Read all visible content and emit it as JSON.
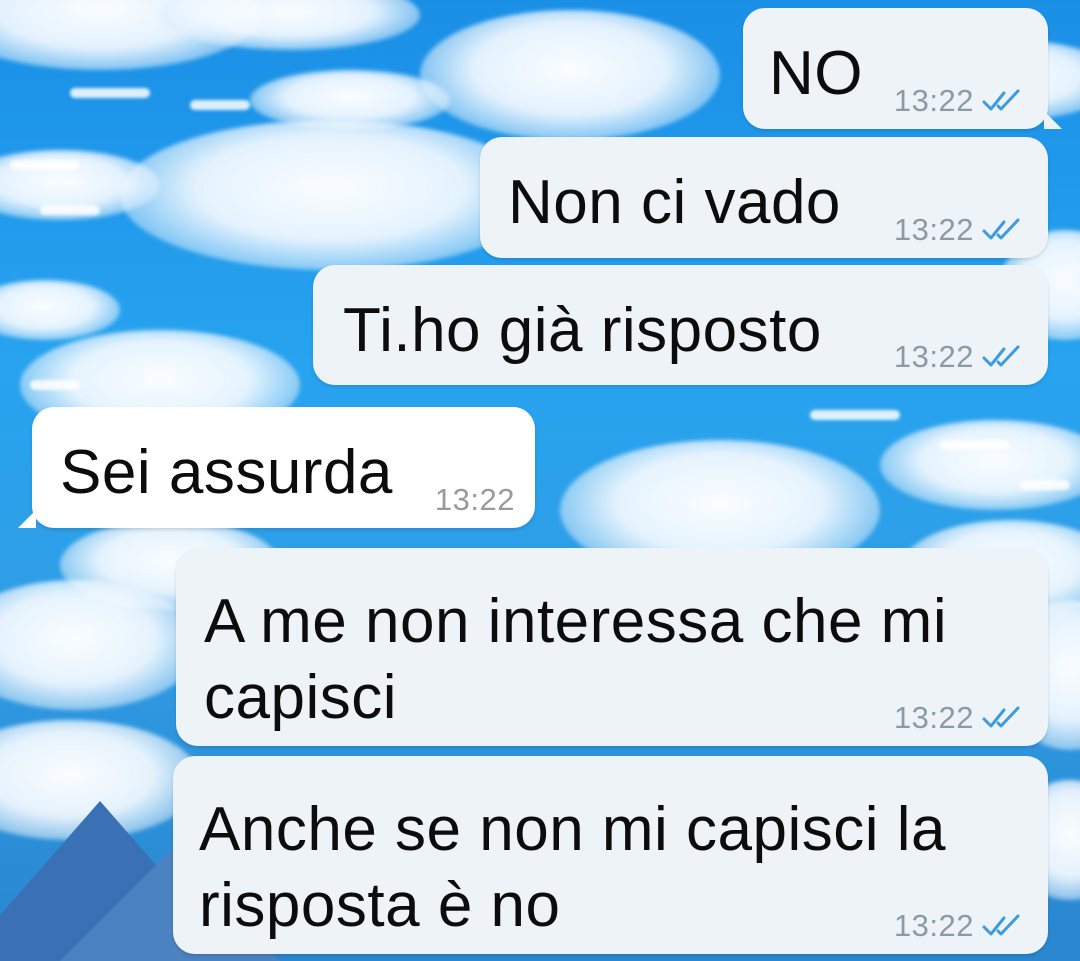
{
  "messages": [
    {
      "text": "NO",
      "time": "13:22",
      "direction": "outgoing",
      "status": "read"
    },
    {
      "text": "Non ci vado",
      "time": "13:22",
      "direction": "outgoing",
      "status": "read"
    },
    {
      "text": "Ti.ho già risposto",
      "time": "13:22",
      "direction": "outgoing",
      "status": "read"
    },
    {
      "text": "Sei assurda",
      "time": "13:22",
      "direction": "incoming"
    },
    {
      "text": "A me non interessa che mi\ncapisci",
      "time": "13:22",
      "direction": "outgoing",
      "status": "read"
    },
    {
      "text": "Anche se non mi capisci la\nrisposta è no",
      "time": "13:22",
      "direction": "outgoing",
      "status": "read"
    }
  ],
  "colors": {
    "outgoing_bubble": "#eef3f8",
    "incoming_bubble": "#ffffff",
    "read_ticks": "#3d9be0",
    "sky": "#27a3ef"
  },
  "icons": {
    "read_status": "double-check-icon"
  }
}
